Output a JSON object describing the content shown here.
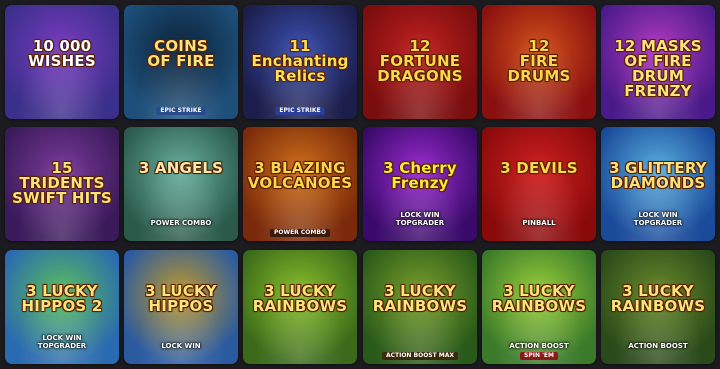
{
  "games": [
    {
      "title": "10 000\nWISHES",
      "sub": "",
      "badge": "",
      "bg": "#3a2f8a",
      "bg2": "#7a3bc0",
      "title_color": "#ffffff",
      "badge_color": "#000000",
      "icon": "wheel-icon"
    },
    {
      "title": "COINS\nOF FIRE",
      "sub": "",
      "badge": "EPIC STRIKE",
      "bg": "#1d4f7a",
      "bg2": "#0c2238",
      "title_color": "#ffe27a",
      "badge_color": "#274b8c",
      "icon": "coin-icon"
    },
    {
      "title": "11\nEnchanting\nRelics",
      "sub": "",
      "badge": "EPIC STRIKE",
      "bg": "#1b1d4a",
      "bg2": "#3b4fb0",
      "title_color": "#ffdd55",
      "badge_color": "#2a3f9a",
      "icon": "relic-icon"
    },
    {
      "title": "12\nFORTUNE\nDRAGONS",
      "sub": "",
      "badge": "",
      "bg": "#7a0d0d",
      "bg2": "#c02020",
      "title_color": "#ffd54a",
      "badge_color": "#000000",
      "icon": "dragon-icon"
    },
    {
      "title": "12\nFIRE DRUMS",
      "sub": "",
      "badge": "",
      "bg": "#8a1010",
      "bg2": "#d0501a",
      "title_color": "#ffd54a",
      "badge_color": "#000000",
      "icon": "drum-icon"
    },
    {
      "title": "12 MASKS OF FIRE\nDRUM\nFRENZY",
      "sub": "",
      "badge": "",
      "bg": "#4b1a8a",
      "bg2": "#b03ac0",
      "title_color": "#ffe37a",
      "badge_color": "#000000",
      "icon": "mask-icon"
    },
    {
      "title": "15\nTRIDENTS\nSWIFT HITS",
      "sub": "",
      "badge": "",
      "bg": "#3a1a5a",
      "bg2": "#7a3a9a",
      "title_color": "#ffe37a",
      "badge_color": "#000000",
      "icon": "trident-icon"
    },
    {
      "title": "3 ANGELS",
      "sub": "POWER COMBO",
      "badge": "",
      "bg": "#2a5a4a",
      "bg2": "#6ab0a0",
      "title_color": "#ffe9a8",
      "badge_color": "#000000",
      "icon": "angel-icon"
    },
    {
      "title": "3 BLAZING\nVOLCANOES",
      "sub": "",
      "badge": "POWER COMBO",
      "bg": "#7a2a0a",
      "bg2": "#d0701a",
      "title_color": "#ffd54a",
      "badge_color": "#3a1a0a",
      "icon": "volcano-icon"
    },
    {
      "title": "3 Cherry\nFrenzy",
      "sub": "LOCK WIN\nTOPGRADER",
      "badge": "",
      "bg": "#3a0a6a",
      "bg2": "#9a2ad0",
      "title_color": "#ffea3a",
      "badge_color": "#000000",
      "icon": "cherry-icon"
    },
    {
      "title": "3 DEVILS",
      "sub": "PINBALL",
      "badge": "",
      "bg": "#8a0a0a",
      "bg2": "#d02020",
      "title_color": "#ffd54a",
      "badge_color": "#000000",
      "icon": "devil-icon"
    },
    {
      "title": "3 GLITTERY\nDIAMONDS",
      "sub": "LOCK WIN\nTOPGRADER",
      "badge": "",
      "bg": "#1a4a9a",
      "bg2": "#5ab0e0",
      "title_color": "#ffe37a",
      "badge_color": "#000000",
      "icon": "diamond-icon"
    },
    {
      "title": "3 LUCKY\nHIPPOS 2",
      "sub": "LOCK WIN\nTOPGRADER",
      "badge": "",
      "bg": "#2a6ab0",
      "bg2": "#5ac05a",
      "title_color": "#ffe37a",
      "badge_color": "#000000",
      "icon": "hippo-icon"
    },
    {
      "title": "3 LUCKY\nHIPPOS",
      "sub": "LOCK WIN",
      "badge": "",
      "bg": "#2a5aa0",
      "bg2": "#c09a2a",
      "title_color": "#ffe37a",
      "badge_color": "#000000",
      "icon": "hippo-icon"
    },
    {
      "title": "3 LUCKY\nRAINBOWS",
      "sub": "",
      "badge": "",
      "bg": "#3a6a1a",
      "bg2": "#8ac02a",
      "title_color": "#ffe37a",
      "badge_color": "#000000",
      "icon": "pot-icon"
    },
    {
      "title": "3 LUCKY\nRAINBOWS",
      "sub": "",
      "badge": "ACTION BOOST MAX",
      "bg": "#2a5a1a",
      "bg2": "#7aa02a",
      "title_color": "#ffe37a",
      "badge_color": "#3a2a0a",
      "icon": "pot-icon"
    },
    {
      "title": "3 LUCKY\nRAINBOWS",
      "sub": "ACTION BOOST",
      "badge": "SPIN 'EM",
      "bg": "#3a7a2a",
      "bg2": "#9ad03a",
      "title_color": "#ffe37a",
      "badge_color": "#8a1a1a",
      "icon": "pot-icon"
    },
    {
      "title": "3 LUCKY\nRAINBOWS",
      "sub": "ACTION BOOST",
      "badge": "",
      "bg": "#2a4a1a",
      "bg2": "#6a8a2a",
      "title_color": "#ffe37a",
      "badge_color": "#000000",
      "icon": "pot-icon"
    }
  ]
}
